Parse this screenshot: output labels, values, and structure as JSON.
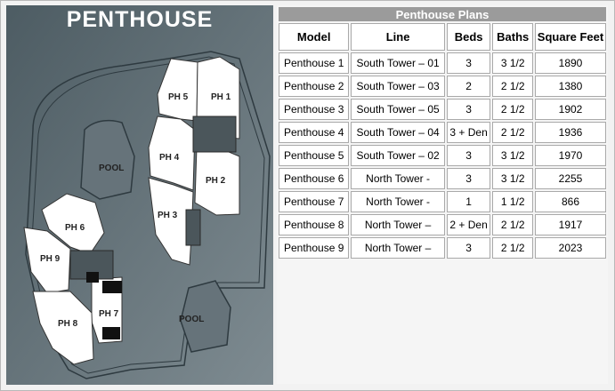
{
  "plan": {
    "title": "PENTHOUSE",
    "labels": {
      "ph1": "PH 1",
      "ph2": "PH 2",
      "ph3": "PH 3",
      "ph4": "PH 4",
      "ph5": "PH 5",
      "ph6": "PH 6",
      "ph7": "PH 7",
      "ph8": "PH 8",
      "ph9": "PH 9",
      "pool_top": "POOL",
      "pool_bottom": "POOL"
    }
  },
  "table": {
    "caption": "Penthouse Plans",
    "headers": [
      "Model",
      "Line",
      "Beds",
      "Baths",
      "Square Feet"
    ],
    "rows": [
      [
        "Penthouse 1",
        "South Tower – 01",
        "3",
        "3 1/2",
        "1890"
      ],
      [
        "Penthouse 2",
        "South Tower – 03",
        "2",
        "2 1/2",
        "1380"
      ],
      [
        "Penthouse 3",
        "South Tower – 05",
        "3",
        "2 1/2",
        "1902"
      ],
      [
        "Penthouse 4",
        "South Tower – 04",
        "3 + Den",
        "2 1/2",
        "1936"
      ],
      [
        "Penthouse 5",
        "South Tower – 02",
        "3",
        "3 1/2",
        "1970"
      ],
      [
        "Penthouse 6",
        "North Tower -",
        "3",
        "3 1/2",
        "2255"
      ],
      [
        "Penthouse 7",
        "North Tower -",
        "1",
        "1 1/2",
        "866"
      ],
      [
        "Penthouse 8",
        "North Tower –",
        "2 + Den",
        "2 1/2",
        "1917"
      ],
      [
        "Penthouse 9",
        "North Tower –",
        "3",
        "2 1/2",
        "2023"
      ]
    ]
  }
}
